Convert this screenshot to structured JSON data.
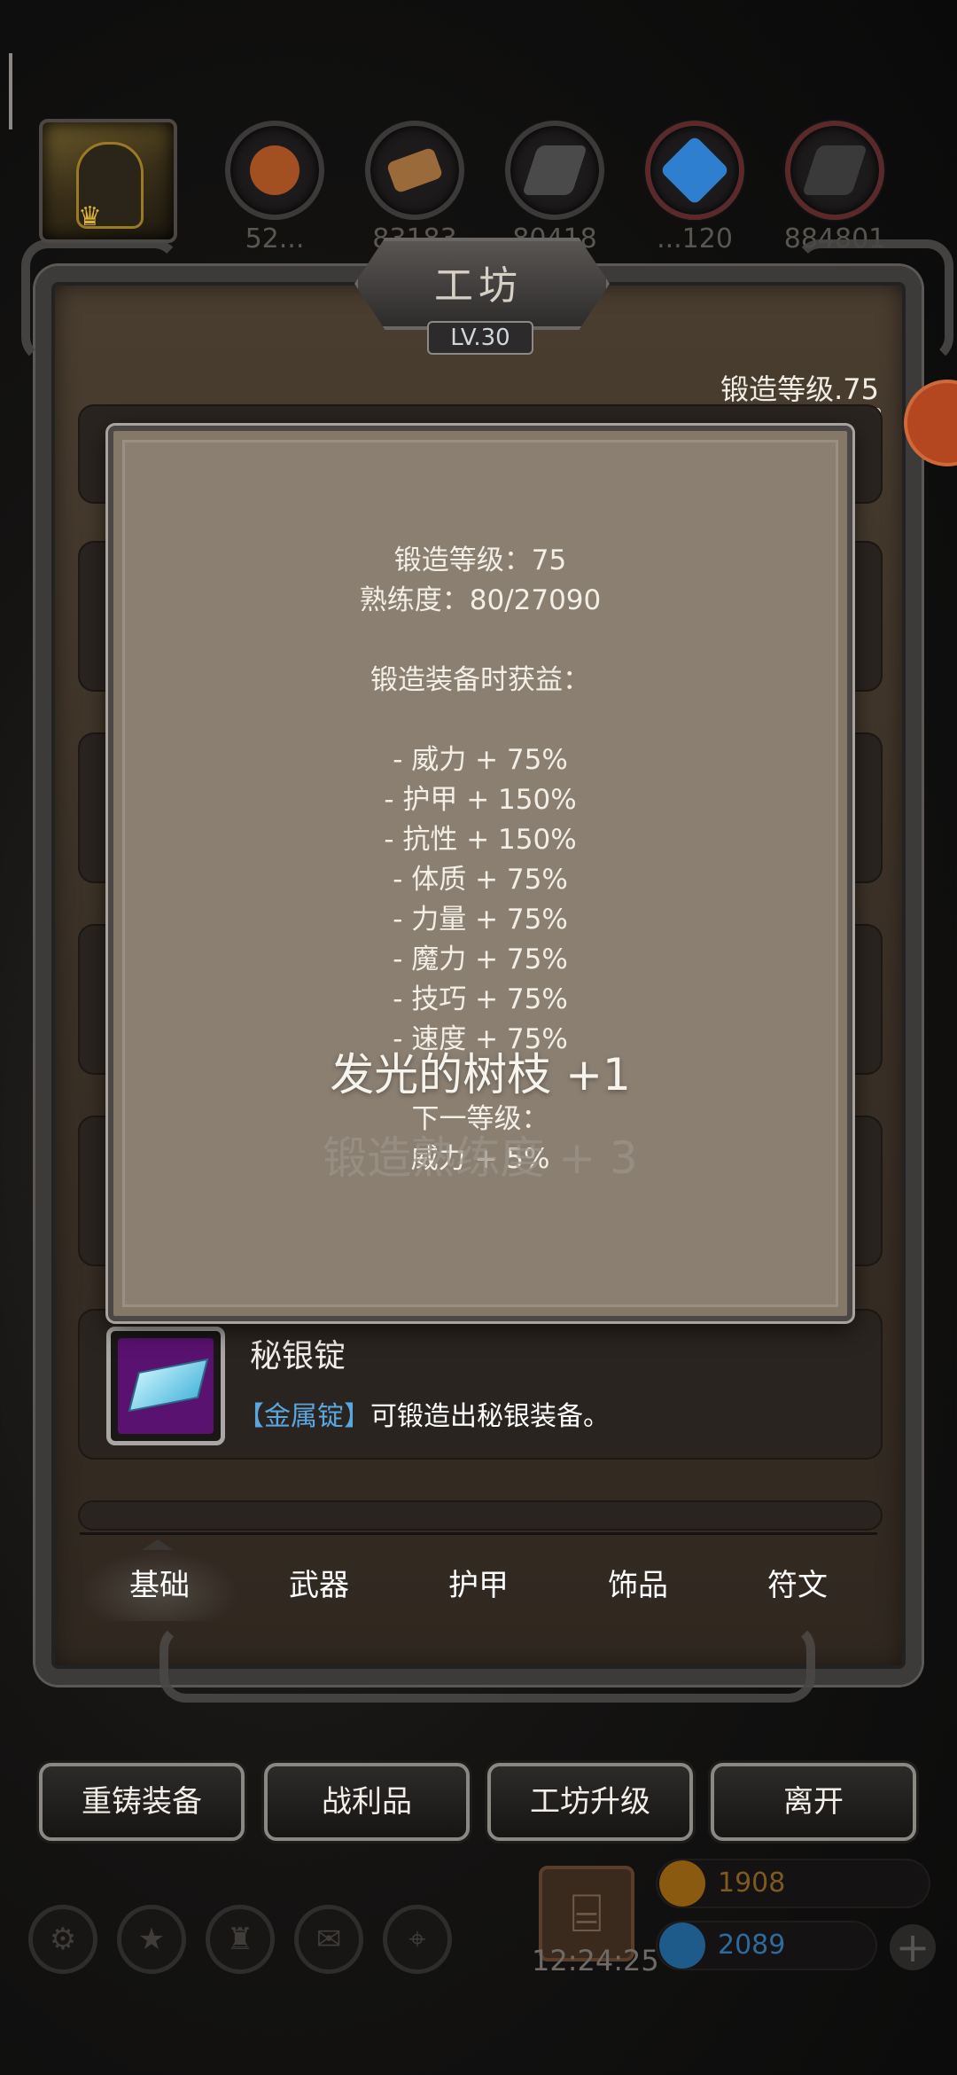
{
  "header": {
    "resources": [
      {
        "icon": "copper-ore-icon",
        "color": "#a24f22",
        "count": "52..."
      },
      {
        "icon": "wood-plank-icon",
        "color": "#9a6a3a",
        "count": "83183"
      },
      {
        "icon": "iron-ingot-icon",
        "color": "#4a4a4a",
        "count": "80418"
      },
      {
        "icon": "crystal-icon",
        "color": "#2f7fd0",
        "count": "...120"
      },
      {
        "icon": "dark-ingot-icon",
        "color": "#3a3a3a",
        "count": "884801"
      }
    ]
  },
  "workshop": {
    "title": "工坊",
    "level_badge": "LV.30",
    "forge_level_label": "锻造等级.75",
    "forge_progress": 0.003
  },
  "tooltip": {
    "lines": [
      "锻造等级：75",
      "熟练度：80/27090",
      "",
      "锻造装备时获益：",
      "",
      "- 威力 + 75%",
      "- 护甲 + 150%",
      "- 抗性 + 150%",
      "- 体质 + 75%",
      "- 力量 + 75%",
      "- 魔力 + 75%",
      "- 技巧 + 75%",
      "- 速度 + 75%",
      "",
      "下一等级：",
      "威力 + 5%"
    ]
  },
  "floating_text": {
    "main": "发光的树枝 +1",
    "sub": "锻造熟练度 + 3"
  },
  "list": {
    "visible_item": {
      "title": "秘银锭",
      "desc_tag": "【金属锭】",
      "desc_text": "可锻造出秘银装备。"
    }
  },
  "tabs": {
    "basic": "基础",
    "weapon": "武器",
    "armor": "护甲",
    "accessory": "饰品",
    "rune": "符文"
  },
  "buttons": {
    "reforge": "重铸装备",
    "loot": "战利品",
    "upgrade": "工坊升级",
    "leave": "离开"
  },
  "footer": {
    "timer": "12:24:25",
    "gold": "1908",
    "gems": "2089",
    "gold_color": "#c78a1c",
    "gem_color": "#3a8fd8"
  }
}
